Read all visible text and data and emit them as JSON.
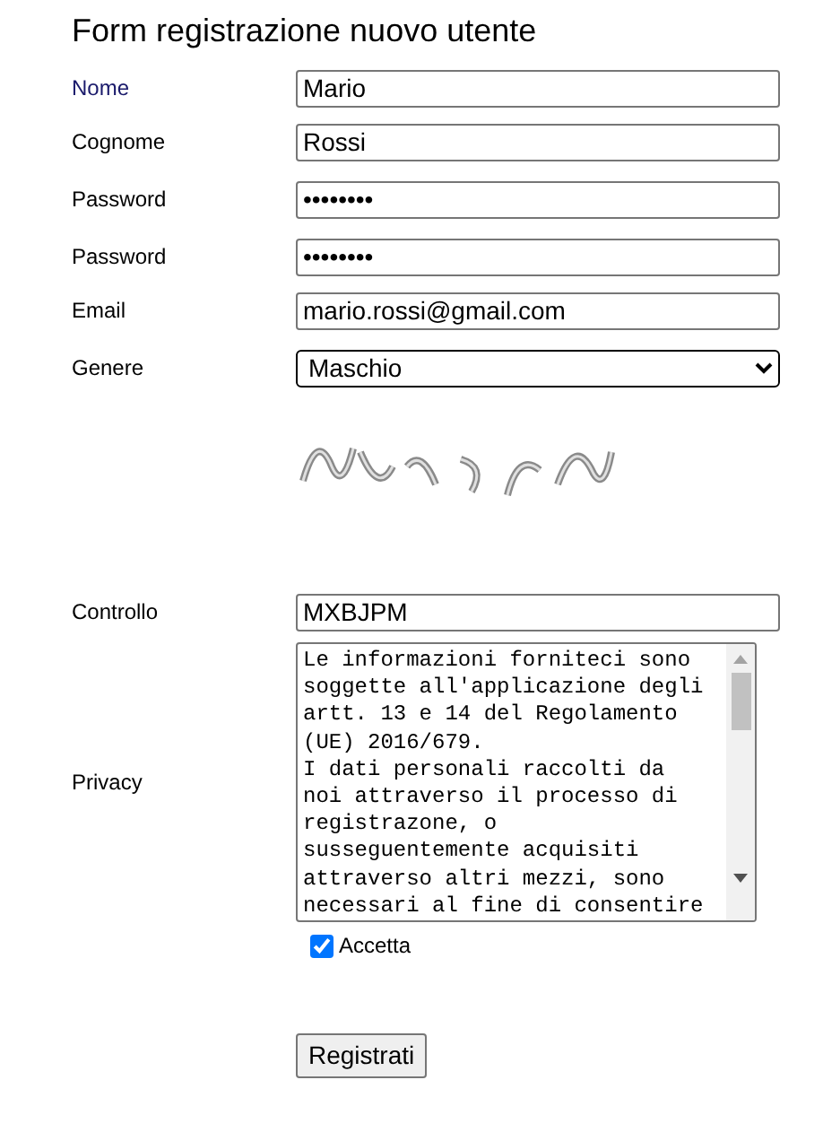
{
  "title": "Form registrazione nuovo utente",
  "fields": [
    {
      "kind": "text",
      "label": "Nome",
      "value": "Mario"
    },
    {
      "kind": "text",
      "label": "Cognome",
      "value": "Rossi"
    },
    {
      "kind": "text",
      "label": "Password",
      "value": "••••••••"
    },
    {
      "kind": "text",
      "label": "Password",
      "value": "••••••••"
    },
    {
      "kind": "text",
      "label": "Email",
      "value": "mario.rossi@gmail.com"
    },
    {
      "kind": "select",
      "label": "Genere",
      "value": "Maschio"
    },
    {
      "kind": "captcha"
    },
    {
      "kind": "text",
      "label": "Controllo",
      "value": "MXBJPM"
    },
    {
      "kind": "textarea",
      "label": "Privacy",
      "lines": [
        "Le informazioni forniteci sono",
        "soggette all'applicazione degli",
        "artt. 13 e 14 del Regolamento",
        "(UE) 2016/679.",
        "I dati personali raccolti da",
        "noi attraverso il processo di",
        "registrazone, o",
        "susseguentemente acquisiti",
        "attraverso altri mezzi, sono",
        "necessari al fine di consentire"
      ]
    },
    {
      "kind": "checkbox",
      "label": "Accetta",
      "checked": true
    }
  ],
  "submit": "Registrati"
}
